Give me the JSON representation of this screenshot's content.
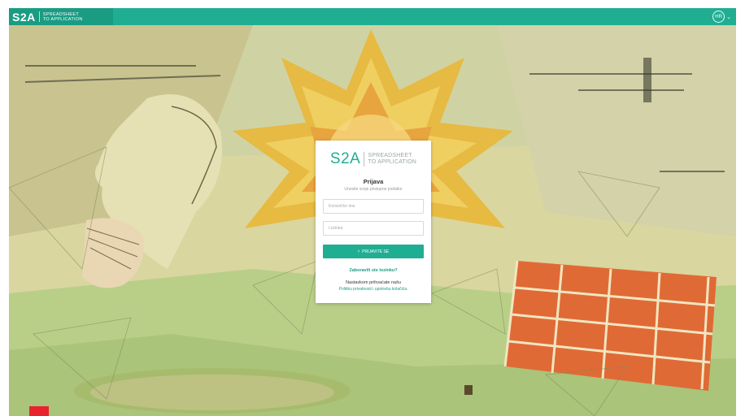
{
  "header": {
    "brand_mark": "S2A",
    "brand_line1": "SPREADSHEET",
    "brand_line2": "TO APPLICATION",
    "language": "HR",
    "language_caret": "⌄"
  },
  "card": {
    "logo_mark": "S2A",
    "logo_line1": "SPREADSHEET",
    "logo_line2": "TO APPLICATION",
    "title": "Prijava",
    "subtitle": "Unesite svoje pristupne podatke",
    "username_placeholder": "Korisničko ime",
    "password_placeholder": "Lozinka",
    "login_icon": "›",
    "login_label": "PRIJAVITE SE",
    "forgot_label": "Zaboravili ste lozinku?",
    "legal_text": "Nastavkom prihvaćate našu",
    "legal_link": "Politiku privatnosti i upotrebu kolačića."
  },
  "colors": {
    "accent": "#1fae92",
    "accent_dark": "#1a9c83",
    "corner_mark": "#e8232d"
  },
  "icons": {
    "login": "chevron-right-icon",
    "language": "chevron-down-icon"
  }
}
